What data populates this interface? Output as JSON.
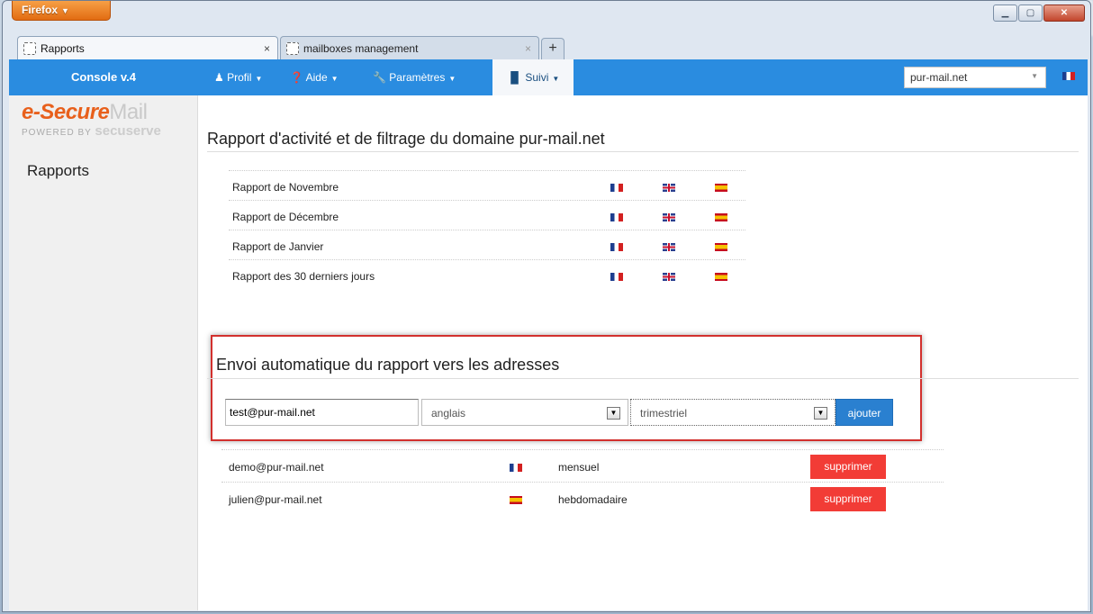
{
  "browser": {
    "app_button": "Firefox",
    "tabs": [
      {
        "title": "Rapports",
        "active": true
      },
      {
        "title": "mailboxes management",
        "active": false
      }
    ],
    "new_tab": "+",
    "close_glyph": "×"
  },
  "navbar": {
    "brand": "Console v.4",
    "items": [
      {
        "label": "Profil",
        "icon": "user-icon"
      },
      {
        "label": "Aide",
        "icon": "help-icon"
      },
      {
        "label": "Paramètres",
        "icon": "wrench-icon"
      },
      {
        "label": "Suivi",
        "icon": "chart-icon",
        "active": true
      }
    ],
    "domain_select": "pur-mail.net",
    "accent": "#2a8ce0"
  },
  "sidebar": {
    "logo_line1": "e-Secure",
    "logo_line1b": "Mail",
    "logo_line2": "POWERED BY",
    "logo_line2b": "secuserve",
    "title": "Rapports"
  },
  "reports": {
    "heading": "Rapport d'activité et de filtrage du domaine pur-mail.net",
    "rows": [
      {
        "label": "Rapport de Novembre"
      },
      {
        "label": "Rapport de Décembre"
      },
      {
        "label": "Rapport de Janvier"
      },
      {
        "label": "Rapport des 30 derniers jours"
      }
    ]
  },
  "auto_send": {
    "heading": "Envoi automatique du rapport vers les adresses",
    "email_value": "test@pur-mail.net",
    "language_value": "anglais",
    "frequency_value": "trimestriel",
    "add_label": "ajouter",
    "subscribers": [
      {
        "email": "demo@pur-mail.net",
        "flag": "fr",
        "frequency": "mensuel",
        "delete_label": "supprimer"
      },
      {
        "email": "julien@pur-mail.net",
        "flag": "es",
        "frequency": "hebdomadaire",
        "delete_label": "supprimer"
      }
    ]
  }
}
